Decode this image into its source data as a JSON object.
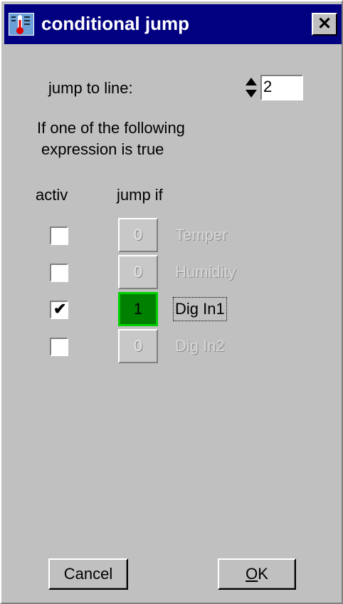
{
  "window": {
    "title": "conditional jump",
    "close_symbol": "✕"
  },
  "jump": {
    "label": "jump to line:",
    "value": "2"
  },
  "description": {
    "line1": "If one of the following",
    "line2": "expression is true"
  },
  "columns": {
    "activ": "activ",
    "jump_if": "jump if"
  },
  "rows": [
    {
      "active": false,
      "value": "0",
      "signal": "Temper",
      "enabled": false
    },
    {
      "active": false,
      "value": "0",
      "signal": "Humidity",
      "enabled": false
    },
    {
      "active": true,
      "value": "1",
      "signal": "Dig In1",
      "enabled": true
    },
    {
      "active": false,
      "value": "0",
      "signal": "Dig In2",
      "enabled": false
    }
  ],
  "buttons": {
    "cancel": "Cancel",
    "ok_mnemonic": "O",
    "ok_rest": "K"
  },
  "colors": {
    "titlebar": "#000080",
    "active_value": "#008000",
    "face": "#c0c0c0"
  }
}
